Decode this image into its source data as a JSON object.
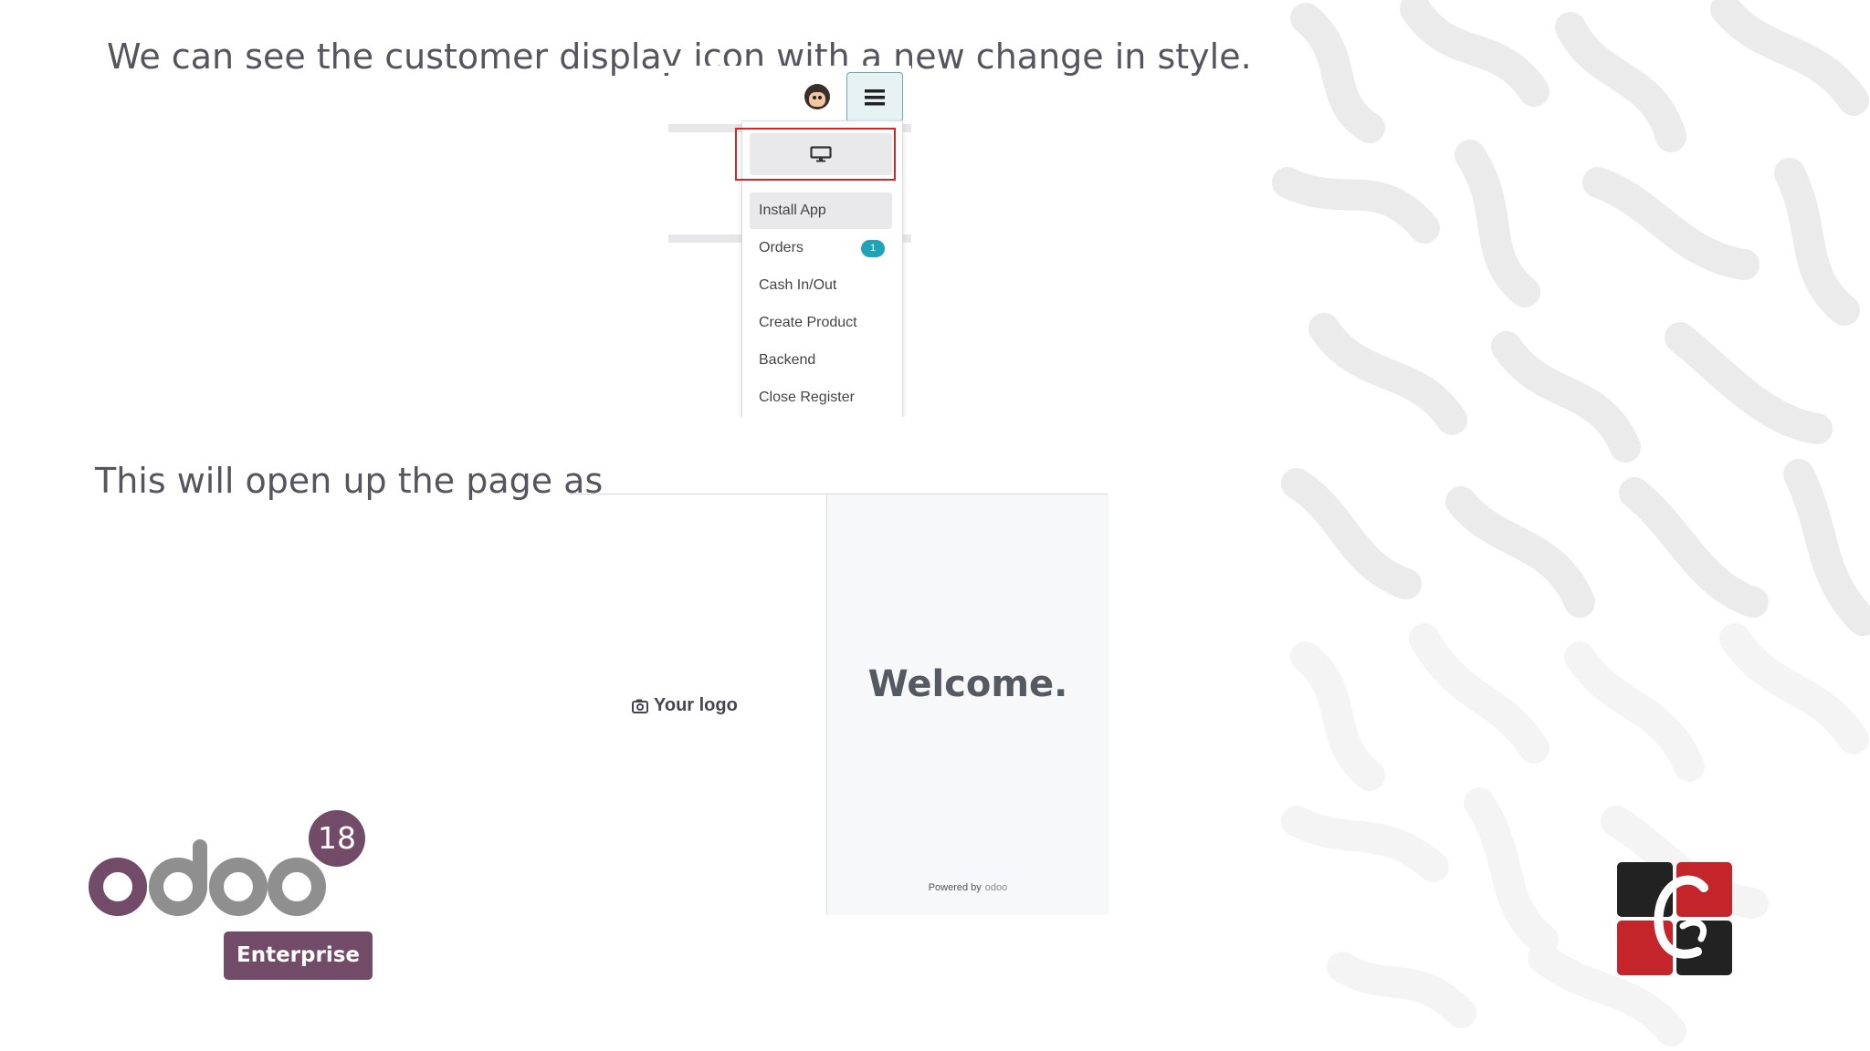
{
  "slide": {
    "caption_1": "We can see the customer display icon with a new change in style.",
    "caption_2": "This will open up the page as"
  },
  "pos_menu": {
    "customer_display_icon": "monitor-icon",
    "menu_icon": "hamburger-menu-icon",
    "items": [
      {
        "label": "Install App"
      },
      {
        "label": "Orders",
        "badge": "1"
      },
      {
        "label": "Cash In/Out"
      },
      {
        "label": "Create Product"
      },
      {
        "label": "Backend"
      },
      {
        "label": "Close Register"
      }
    ]
  },
  "customer_display": {
    "logo_placeholder": "Your logo",
    "welcome": "Welcome.",
    "powered_by": "Powered by",
    "powered_brand": "odoo"
  },
  "branding": {
    "product": "odoo",
    "version": "18",
    "edition": "Enterprise"
  },
  "colors": {
    "odoo_purple": "#714b67",
    "odoo_gray": "#8f8f8f",
    "highlight_red": "#cc2a2a",
    "badge_teal": "#1fa3b6",
    "corner_logo_red": "#c4252b",
    "corner_logo_dark": "#222222"
  }
}
